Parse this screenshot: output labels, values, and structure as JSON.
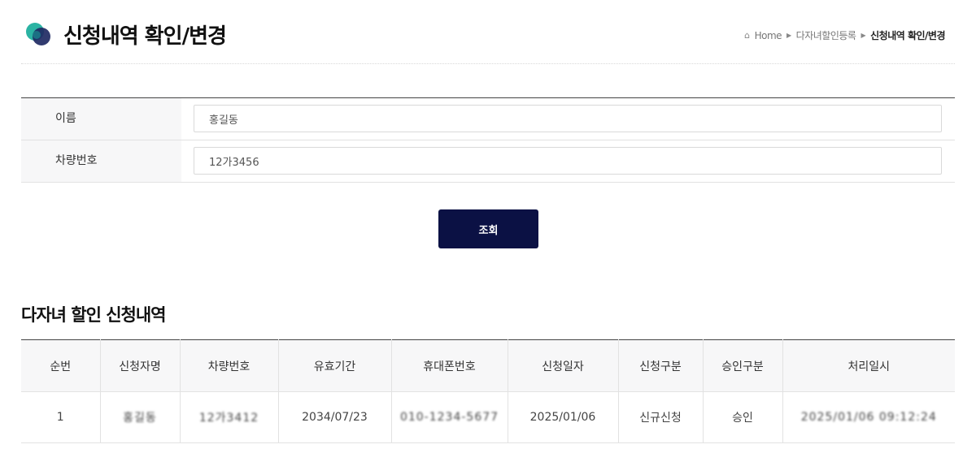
{
  "header": {
    "title": "신청내역 확인/변경",
    "breadcrumb": [
      "Home",
      "다자녀할인등록",
      "신청내역 확인/변경"
    ]
  },
  "form": {
    "fields": [
      {
        "label": "이름",
        "value": "홍길동"
      },
      {
        "label": "차량번호",
        "value": "12가3456"
      }
    ],
    "search_label": "조회"
  },
  "results": {
    "title": "다자녀 할인 신청내역",
    "columns": [
      "순번",
      "신청자명",
      "차량번호",
      "유효기간",
      "휴대폰번호",
      "신청일자",
      "신청구분",
      "승인구분",
      "처리일시"
    ],
    "rows": [
      [
        "1",
        "홍길동",
        "12가3412",
        "2034/07/23",
        "010-1234-5677",
        "2025/01/06",
        "신규신청",
        "승인",
        "2025/01/06 09:12:24"
      ]
    ]
  },
  "colors": {
    "primary_button": "#0b1144",
    "logo_teal": "#2bb3a3",
    "logo_navy": "#1f2a63"
  }
}
